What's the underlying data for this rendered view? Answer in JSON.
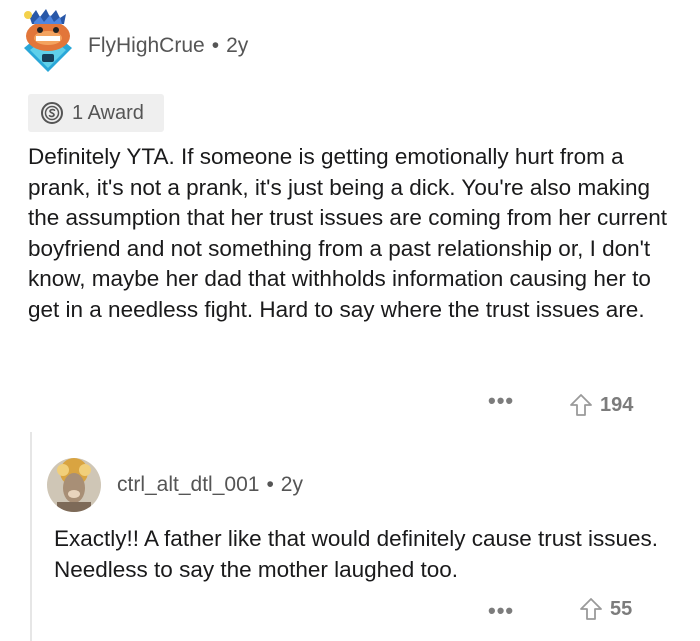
{
  "top_comment": {
    "author": "FlyHighCrue",
    "separator": "•",
    "age": "2y",
    "award_label": "1 Award",
    "body": "Definitely YTA. If someone is getting emotionally hurt from a prank, it's not a prank, it's just being a dick. You're also making the assumption that her trust issues are coming from her current boyfriend and not something from a past relationship or, I don't know, maybe her dad that withholds information causing her to get in a needless fight. Hard to say where the trust issues are.",
    "more_label": "•••",
    "votes": "194"
  },
  "reply": {
    "author": "ctrl_alt_dtl_001",
    "separator": "•",
    "age": "2y",
    "body": "Exactly!! A father like that would definitely cause trust issues. Needless to say the mother laughed too.",
    "more_label": "•••",
    "votes": "55"
  },
  "icons": {
    "avatar1": "snoo-avatar",
    "award": "silver-award-icon",
    "upvote": "upvote-arrow-icon",
    "avatar2": "profile-photo"
  },
  "colors": {
    "meta_text": "#555555",
    "action_gray": "#7c7c7c",
    "award_bg": "#efefef",
    "thread_line": "#e6e6e6"
  }
}
